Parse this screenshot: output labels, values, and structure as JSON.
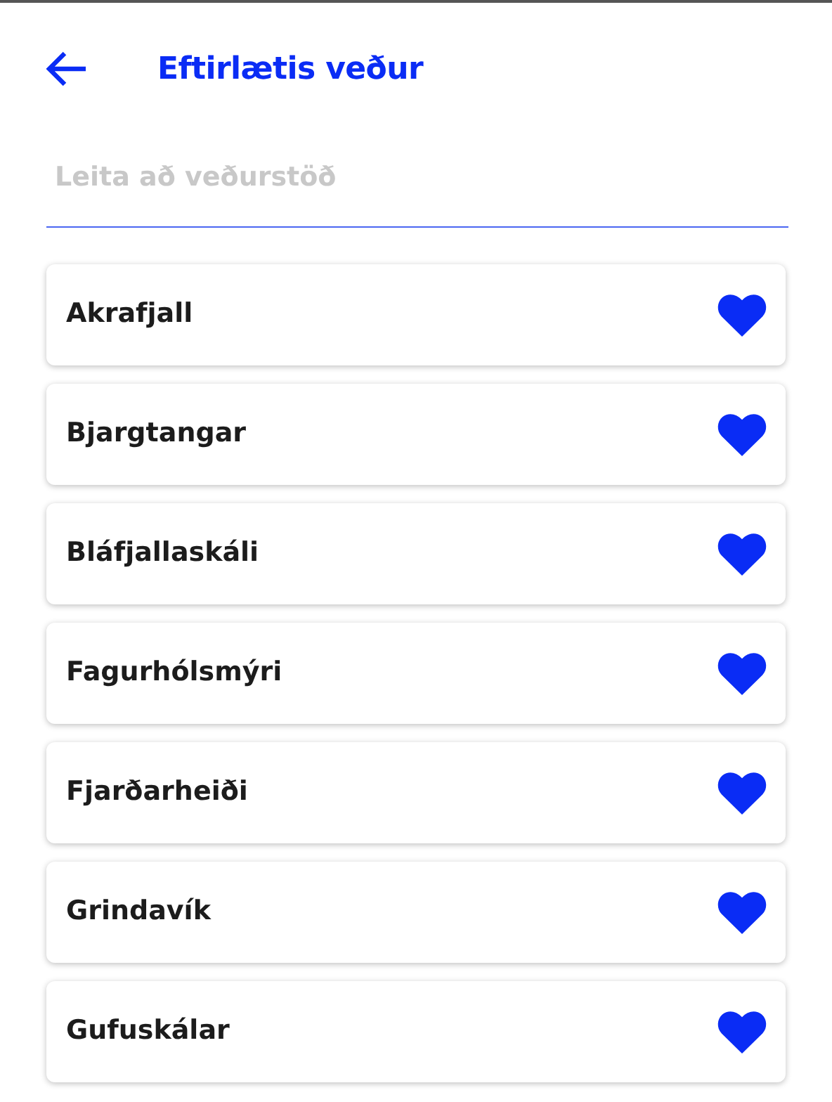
{
  "header": {
    "title": "Eftirlætis veður"
  },
  "search": {
    "placeholder": "Leita að veðurstöð"
  },
  "stations": [
    {
      "name": "Akrafjall",
      "favorite": true
    },
    {
      "name": "Bjargtangar",
      "favorite": true
    },
    {
      "name": "Bláfjallaskáli",
      "favorite": true
    },
    {
      "name": "Fagurhólsmýri",
      "favorite": true
    },
    {
      "name": "Fjarðarheiði",
      "favorite": true
    },
    {
      "name": "Grindavík",
      "favorite": true
    },
    {
      "name": "Gufuskálar",
      "favorite": true
    }
  ]
}
